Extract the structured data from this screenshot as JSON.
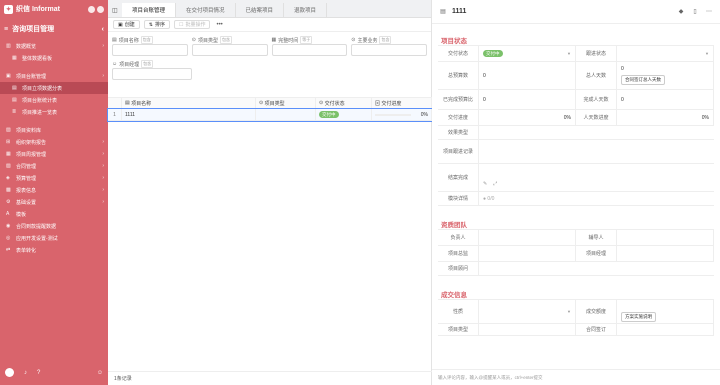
{
  "sidebar": {
    "brand": "织信 Informat",
    "title": "咨询项目管理",
    "items": [
      {
        "label": "数据概览",
        "sub": false,
        "chevron": true,
        "icon": "chart-icon"
      },
      {
        "label": "整体数据看板",
        "sub": true,
        "chevron": false,
        "icon": "dashboard-icon"
      },
      {
        "label": "项目台账管理",
        "sub": false,
        "chevron": true,
        "icon": "folder-icon"
      },
      {
        "label": "项目立项数据分表",
        "sub": true,
        "chevron": false,
        "icon": "table-icon",
        "active": true
      },
      {
        "label": "项目台账统计表",
        "sub": true,
        "chevron": false,
        "icon": "table-icon"
      },
      {
        "label": "项目推进一览表",
        "sub": true,
        "chevron": false,
        "icon": "list-icon"
      },
      {
        "label": "项目资料库",
        "sub": false,
        "chevron": false,
        "icon": "book-icon"
      },
      {
        "label": "组织架构报告",
        "sub": false,
        "chevron": true,
        "icon": "org-icon"
      },
      {
        "label": "项目周报管理",
        "sub": false,
        "chevron": true,
        "icon": "calendar-icon"
      },
      {
        "label": "合同管理",
        "sub": false,
        "chevron": true,
        "icon": "contract-icon"
      },
      {
        "label": "预算管理",
        "sub": false,
        "chevron": true,
        "icon": "budget-icon"
      },
      {
        "label": "报表信息",
        "sub": false,
        "chevron": true,
        "icon": "report-icon"
      },
      {
        "label": "基础设置",
        "sub": false,
        "chevron": true,
        "icon": "settings-icon"
      },
      {
        "label": "模板",
        "sub": false,
        "chevron": false,
        "icon": "template-icon"
      },
      {
        "label": "合同到款提醒数据",
        "sub": false,
        "chevron": false,
        "icon": "bell-icon"
      },
      {
        "label": "应用开发设置-测试",
        "sub": false,
        "chevron": false,
        "icon": "dev-icon"
      },
      {
        "label": "表单转化",
        "sub": false,
        "chevron": false,
        "icon": "convert-icon"
      }
    ]
  },
  "tabs": [
    {
      "label": "项目台账管理",
      "active": true
    },
    {
      "label": "在交付项目情况",
      "active": false
    },
    {
      "label": "已结案项目",
      "active": false
    },
    {
      "label": "退款项目",
      "active": false
    }
  ],
  "toolbar": {
    "create": "创建",
    "sort": "排序",
    "batch": "批量操作",
    "more": "•••"
  },
  "filters": [
    {
      "label": "项目名称",
      "tag": "包含"
    },
    {
      "label": "项目类型",
      "tag": "包含"
    },
    {
      "label": "完整时间",
      "tag": "等于"
    },
    {
      "label": "主要业务",
      "tag": "包含"
    },
    {
      "label": "项目经理",
      "tag": "包含"
    }
  ],
  "grid": {
    "columns": [
      "项目名称",
      "项目类型",
      "交付状态",
      "交付进度"
    ],
    "rows": [
      {
        "num": "1",
        "name": "1111",
        "type": "",
        "status": "交付中",
        "progress": "0%",
        "progress_value": 0
      }
    ],
    "footer": "1条记录"
  },
  "detail": {
    "title": "1111",
    "sections": {
      "status": "项目状态",
      "team": "资质团队",
      "deal": "成交信息"
    },
    "fields": {
      "delivery_status_label": "交付状态",
      "delivery_status_value": "交付中",
      "followup_status_label": "跟进状态",
      "total_budget_label": "总预算数",
      "total_budget_value": "0",
      "total_people_label": "总人天数",
      "total_people_value": "0",
      "total_people_note": "合同签订总人天数",
      "used_budget_label": "已完成预算比",
      "used_budget_value": "0",
      "done_people_label": "完成人天数",
      "done_people_value": "0",
      "delivery_progress_label": "交付进度",
      "delivery_progress_value": "0%",
      "people_progress_label": "人天数进度",
      "people_progress_value": "0%",
      "effect_label": "效果类型",
      "record_label": "项目跟进记录",
      "result_label": "结案完成",
      "module_label": "模块详情",
      "module_value": "●  0/0",
      "owner_label": "负责人",
      "leader_label": "辅导人",
      "director_label": "项目总监",
      "manager_label": "项目经理",
      "advisor_label": "项目顾问",
      "price_label": "性质",
      "deal_amount_label": "成交额度",
      "deal_amount_note": "方案实施说明",
      "type_label": "项目类型",
      "pay_label": "合同签订"
    },
    "comment_placeholder": "输入评论内容，输入@提醒某人或员，ctrl+enter提交"
  }
}
